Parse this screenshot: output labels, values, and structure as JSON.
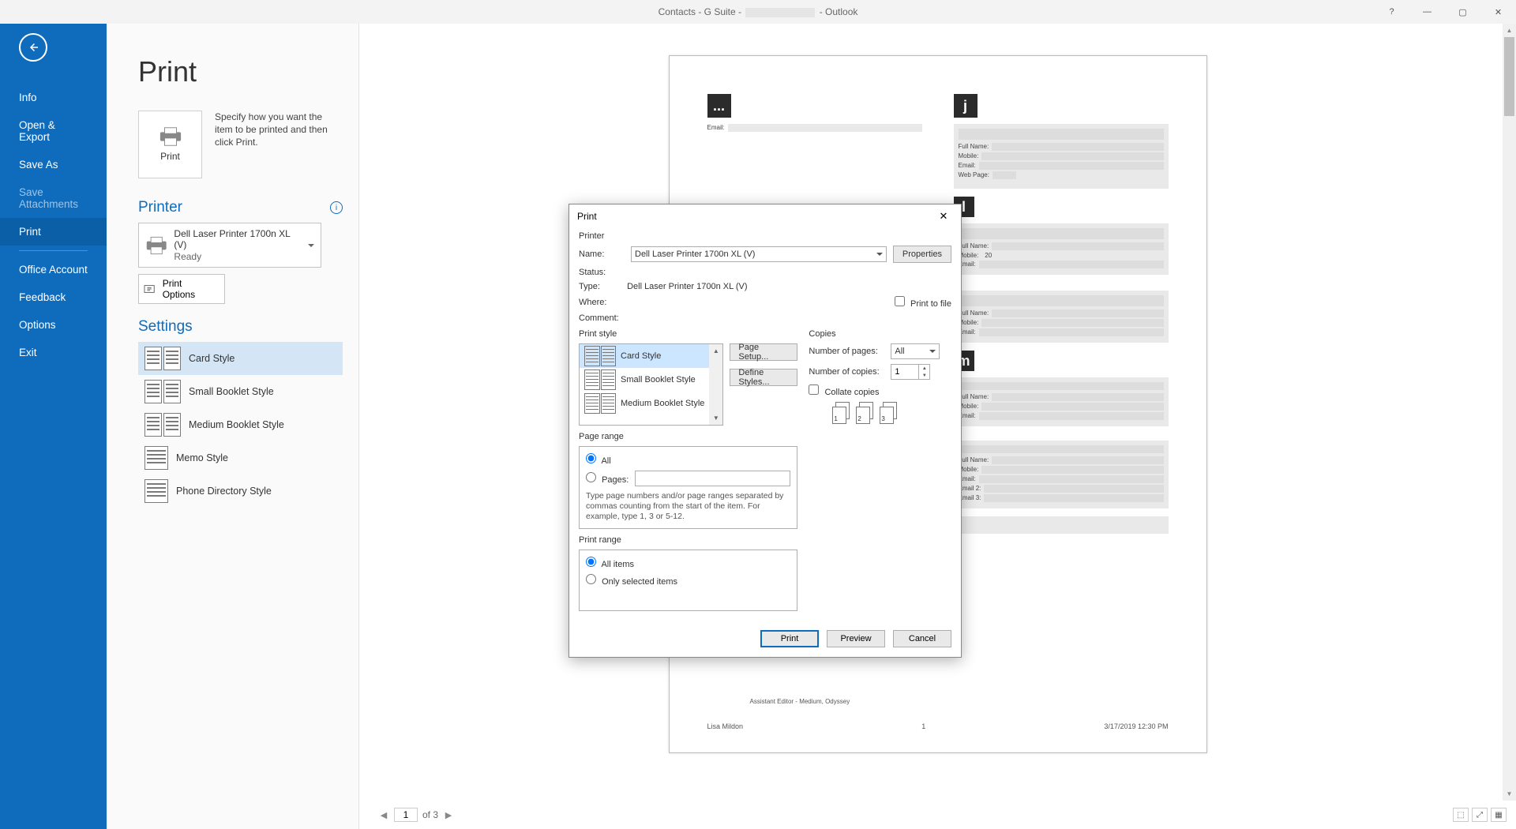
{
  "window": {
    "title_prefix": "Contacts - G Suite -",
    "title_suffix": "-  Outlook",
    "help": "?"
  },
  "sidebar": {
    "items": [
      {
        "label": "Info"
      },
      {
        "label": "Open & Export"
      },
      {
        "label": "Save As"
      },
      {
        "label": "Save Attachments"
      },
      {
        "label": "Print"
      },
      {
        "label": "Office Account"
      },
      {
        "label": "Feedback"
      },
      {
        "label": "Options"
      },
      {
        "label": "Exit"
      }
    ]
  },
  "page": {
    "title": "Print",
    "print_tile": "Print",
    "print_desc": "Specify how you want the item to be printed and then click Print.",
    "printer_heading": "Printer",
    "printer_name": "Dell Laser Printer 1700n XL (V)",
    "printer_status": "Ready",
    "print_options_btn": "Print Options",
    "settings_heading": "Settings",
    "styles": [
      {
        "label": "Card Style"
      },
      {
        "label": "Small Booklet Style"
      },
      {
        "label": "Medium Booklet Style"
      },
      {
        "label": "Memo Style"
      },
      {
        "label": "Phone Directory Style"
      }
    ]
  },
  "dialog": {
    "title": "Print",
    "printer": {
      "group": "Printer",
      "name_lbl": "Name:",
      "name_val": "Dell Laser Printer 1700n XL (V)",
      "properties_btn": "Properties",
      "status_lbl": "Status:",
      "type_lbl": "Type:",
      "type_val": "Dell Laser Printer 1700n XL (V)",
      "where_lbl": "Where:",
      "comment_lbl": "Comment:",
      "print_to_file": "Print to file"
    },
    "print_style": {
      "group": "Print style",
      "items": [
        {
          "label": "Card Style"
        },
        {
          "label": "Small Booklet Style"
        },
        {
          "label": "Medium Booklet Style"
        }
      ],
      "page_setup_btn": "Page Setup...",
      "define_styles_btn": "Define Styles..."
    },
    "page_range": {
      "group": "Page range",
      "all_lbl": "All",
      "pages_lbl": "Pages:",
      "hint": "Type page numbers and/or page ranges separated by commas counting from the start of the item.  For example, type 1, 3 or 5-12."
    },
    "print_range": {
      "group": "Print range",
      "all_items": "All items",
      "selected": "Only selected items"
    },
    "copies": {
      "group": "Copies",
      "num_pages_lbl": "Number of pages:",
      "num_pages_val": "All",
      "num_copies_lbl": "Number of copies:",
      "num_copies_val": "1",
      "collate_lbl": "Collate copies",
      "stacks": [
        "1",
        "2",
        "3"
      ]
    },
    "buttons": {
      "print": "Print",
      "preview": "Preview",
      "cancel": "Cancel"
    }
  },
  "preview": {
    "left_head": "...",
    "right_head": "j",
    "email_lbl": "Email:",
    "fullname_lbl": "Full Name:",
    "mobile_lbl": "Mobile:",
    "email2_lbl": "Email 2:",
    "email3_lbl": "Email 3:",
    "webpage_lbl": "Web Page:",
    "role_line": "Assistant Editor - Medium, Odyssey",
    "footer_left": "Lisa Mildon",
    "footer_center": "1",
    "footer_right": "3/17/2019 12:30 PM",
    "box_m": "m",
    "box_l": "l",
    "val_20": "20"
  },
  "pager": {
    "current": "1",
    "total_label": "of 3"
  }
}
